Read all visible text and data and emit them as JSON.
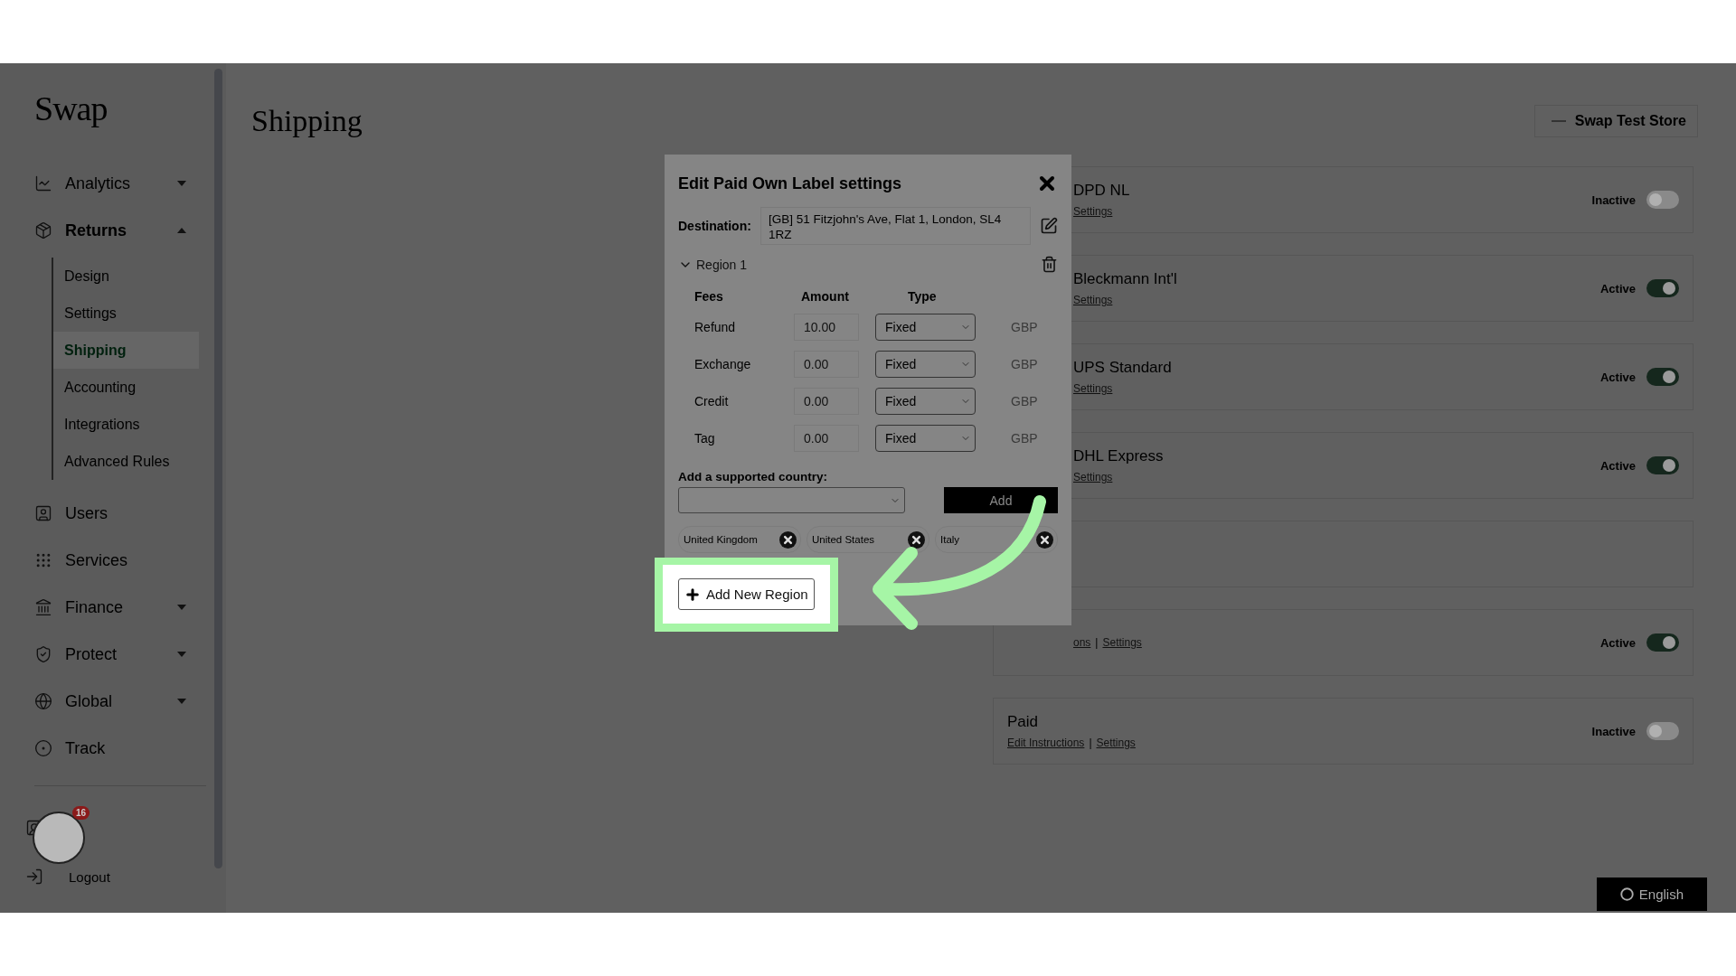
{
  "sidebar": {
    "logo": "Swap",
    "items": [
      {
        "label": "Analytics",
        "expanded": false
      },
      {
        "label": "Returns",
        "expanded": true,
        "children": [
          {
            "label": "Design",
            "selected": false
          },
          {
            "label": "Settings",
            "selected": false
          },
          {
            "label": "Shipping",
            "selected": true
          },
          {
            "label": "Accounting",
            "selected": false
          },
          {
            "label": "Integrations",
            "selected": false
          },
          {
            "label": "Advanced Rules",
            "selected": false
          }
        ]
      },
      {
        "label": "Users"
      },
      {
        "label": "Services"
      },
      {
        "label": "Finance",
        "expanded": false
      },
      {
        "label": "Protect",
        "expanded": false
      },
      {
        "label": "Global",
        "expanded": false
      },
      {
        "label": "Track"
      }
    ],
    "logout": "Logout",
    "avatar_badge": "16"
  },
  "header": {
    "title": "Shipping",
    "store": "Swap Test Store"
  },
  "carriers": [
    {
      "kind": "carrier",
      "title": "DPD NL",
      "links": [
        "Settings"
      ],
      "status": "Inactive",
      "on": false
    },
    {
      "kind": "carrier",
      "title": "Bleckmann Int'l",
      "links": [
        "Settings"
      ],
      "status": "Active",
      "on": true
    },
    {
      "kind": "carrier",
      "title": "UPS Standard",
      "links": [
        "Settings"
      ],
      "status": "Active",
      "on": true
    },
    {
      "kind": "carrier",
      "title": "DHL Express",
      "links": [
        "Settings"
      ],
      "status": "Active",
      "on": true
    },
    {
      "kind": "carrier"
    },
    {
      "kind": "carrier",
      "links": [
        "ons",
        "Settings"
      ],
      "separator": "|",
      "status": "Active",
      "on": true
    },
    {
      "kind": "method",
      "title": "Paid",
      "links": [
        "Edit Instructions",
        "Settings"
      ],
      "separator": "|",
      "status": "Inactive",
      "on": false
    }
  ],
  "modal": {
    "title": "Edit Paid Own Label settings",
    "destination_label": "Destination:",
    "destination": "[GB] 51 Fitzjohn's Ave, Flat 1, London, SL4 1RZ",
    "region": {
      "title": "Region 1",
      "expanded": true,
      "columns": [
        "Fees",
        "Amount",
        "Type"
      ],
      "fees": [
        {
          "name": "Refund",
          "amount": "10.00",
          "type": "Fixed",
          "currency": "GBP"
        },
        {
          "name": "Exchange",
          "amount": "0.00",
          "type": "Fixed",
          "currency": "GBP"
        },
        {
          "name": "Credit",
          "amount": "0.00",
          "type": "Fixed",
          "currency": "GBP"
        },
        {
          "name": "Tag",
          "amount": "0.00",
          "type": "Fixed",
          "currency": "GBP"
        }
      ],
      "country_label": "Add a supported country:",
      "add_button": "Add",
      "countries": [
        "United Kingdom",
        "United States",
        "Italy"
      ]
    },
    "add_region": "Add New Region"
  },
  "language": "English"
}
